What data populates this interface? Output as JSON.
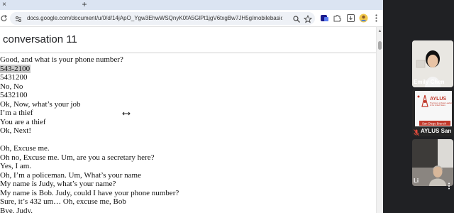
{
  "browser": {
    "url": "docs.google.com/document/u/0/d/14jApO_Ygw3EhwWSQnyK0fA5GlPt1jgV6txgBw7JH5g/mobilebasic",
    "tabs": {
      "close_glyph": "×",
      "new_tab_glyph": "+"
    },
    "icons": [
      "reload-icon",
      "site-info-icon",
      "search-icon",
      "bookmark-star-icon",
      "extension-icon",
      "puzzle-icon",
      "downloads-icon",
      "profile-icon",
      "more-icon"
    ]
  },
  "document": {
    "title": "conversation 11",
    "lines": [
      {
        "text": "Good, and what is your phone number?",
        "highlight": false
      },
      {
        "text": "543-2100",
        "highlight": true
      },
      {
        "text": "5431200",
        "highlight": false
      },
      {
        "text": "No, No",
        "highlight": false
      },
      {
        "text": "5432100",
        "highlight": false
      },
      {
        "text": "Ok, Now, what’s your job",
        "highlight": false
      },
      {
        "text": "I’m a thief",
        "highlight": false
      },
      {
        "text": "You are a thief",
        "highlight": false
      },
      {
        "text": "Ok, Next!",
        "highlight": false
      },
      {
        "text": "",
        "highlight": false
      },
      {
        "text": "Oh, Excuse me.",
        "highlight": false
      },
      {
        "text": "Oh no, Excuse me. Um, are you a secretary here?",
        "highlight": false
      },
      {
        "text": "Yes, I am.",
        "highlight": false
      },
      {
        "text": "Oh, I’m a policeman. Um, What’s your name",
        "highlight": false
      },
      {
        "text": "My name is Judy, what’s your name?",
        "highlight": false
      },
      {
        "text": "My name is Bob. Judy, could I have your phone number?",
        "highlight": false
      },
      {
        "text": "Sure, it’s 432 um… Oh, excuse me, Bob",
        "highlight": false
      },
      {
        "text": "Bye, Judy.",
        "highlight": false
      }
    ]
  },
  "call": {
    "participants": [
      {
        "name": "Emily Chen"
      },
      {
        "name": "AYLUS San Diego"
      },
      {
        "name": "Li"
      }
    ],
    "logo": {
      "title": "AYLUS",
      "subtitle": "The Future of Asian Leaders in the United States",
      "branch": "San Diego Branch"
    }
  },
  "colors": {
    "tabstrip": "#dbe4f2",
    "omnibox": "#eef1f6",
    "highlight": "#c8c8c8",
    "call_bg": "#202124",
    "aylus_red": "#c0392b"
  }
}
